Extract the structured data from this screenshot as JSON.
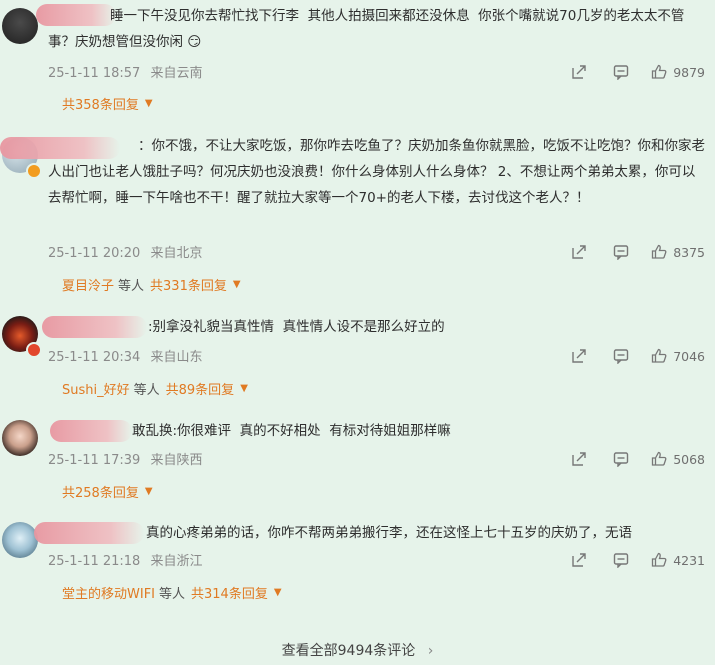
{
  "comments": [
    {
      "text": "睡一下午没见你去帮忙找下行李  其他人拍摄回来都还没休息  你张个嘴就说70几岁的老太太不管事？庆奶想管但没你闲 😏",
      "date": "25-1-11 18:57",
      "location": "来自云南",
      "likes": "9879",
      "reply_user": "",
      "reply_mid": "",
      "reply_count": "共358条回复"
    },
    {
      "text": "：你不饿，不让大家吃饭，那你咋去吃鱼了？庆奶加条鱼你就黑脸，吃饭不让吃饱？你和你家老人出门也让老人饿肚子吗？何况庆奶也没浪费！你什么身体别人什么身体？ 2、不想让两个弟弟太累，你可以去帮忙啊，睡一下午啥也不干！醒了就拉大家等一个70+的老人下楼，去讨伐这个老人？！",
      "date": "25-1-11 20:20",
      "location": "来自北京",
      "likes": "8375",
      "reply_user": "夏目泠子",
      "reply_mid": "等人",
      "reply_count": "共331条回复"
    },
    {
      "text": ":别拿没礼貌当真性情  真性情人设不是那么好立的",
      "date": "25-1-11 20:34",
      "location": "来自山东",
      "likes": "7046",
      "reply_user": "Sushi_好好",
      "reply_mid": "等人",
      "reply_count": "共89条回复"
    },
    {
      "text": "敢乱换:你很难评  真的不好相处  有标对待姐姐那样嘛",
      "date": "25-1-11 17:39",
      "location": "来自陕西",
      "likes": "5068",
      "reply_user": "",
      "reply_mid": "",
      "reply_count": "共258条回复"
    },
    {
      "text": "真的心疼弟弟的话，你咋不帮两弟弟搬行李，还在这怪上七十五岁的庆奶了，无语",
      "date": "25-1-11 21:18",
      "location": "来自浙江",
      "likes": "4231",
      "reply_user": "堂主的移动WIFI",
      "reply_mid": "等人",
      "reply_count": "共314条回复"
    }
  ],
  "footer": {
    "view_all": "查看全部9494条评论",
    "chevron": "›"
  },
  "icons": {
    "share": "share-icon",
    "comment": "comment-icon",
    "like": "thumbs-up-icon",
    "caret": "caret-down-icon"
  },
  "colors": {
    "background": "#e6f3ea",
    "reply_accent": "#e07a23",
    "meta_text": "#8a8a8a"
  }
}
